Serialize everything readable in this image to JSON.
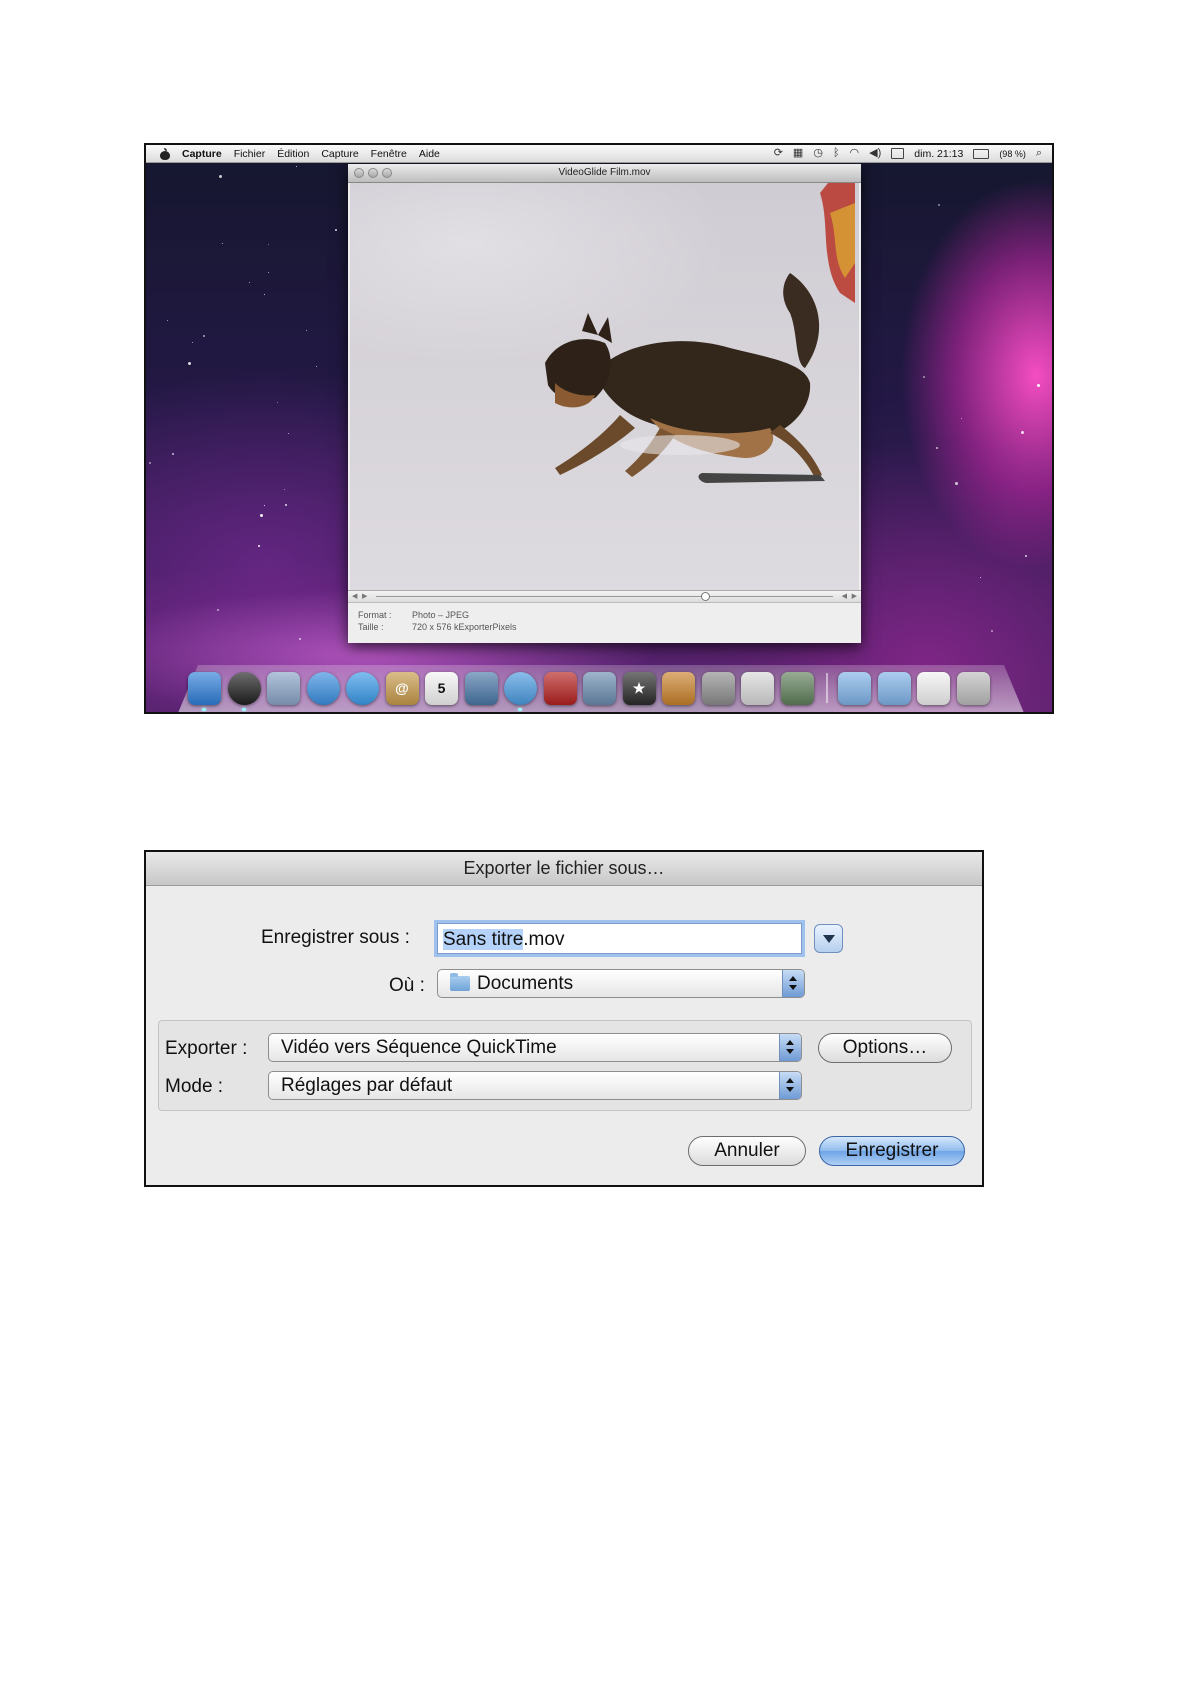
{
  "desktop": {
    "menubar": {
      "app_name": "Capture",
      "items": [
        "Fichier",
        "Édition",
        "Capture",
        "Fenêtre",
        "Aide"
      ],
      "clock": "dim. 21:13",
      "battery": "(98 %)"
    },
    "video_window": {
      "title": "VideoGlide Film.mov",
      "playhead_fraction": 0.72,
      "info": [
        {
          "label": "Format :",
          "value": "Photo – JPEG"
        },
        {
          "label": "Taille :",
          "value": "720 x 576 kExporterPixels"
        }
      ]
    },
    "dock": {
      "apps": [
        {
          "name": "finder-icon",
          "color": "#2f7fd8",
          "glyph": "",
          "round": false
        },
        {
          "name": "dashboard-icon",
          "color": "#1f1f1f",
          "glyph": "",
          "round": true
        },
        {
          "name": "mail-icon",
          "color": "#8aa4c8",
          "glyph": "",
          "round": false
        },
        {
          "name": "safari-icon",
          "color": "#3a8fe0",
          "glyph": "",
          "round": true
        },
        {
          "name": "ichat-icon",
          "color": "#3a9ae8",
          "glyph": "",
          "round": true
        },
        {
          "name": "address-book-icon",
          "color": "#c79a4a",
          "glyph": "@",
          "round": false
        },
        {
          "name": "ical-icon",
          "color": "#f4f4f4",
          "glyph": "5",
          "round": false
        },
        {
          "name": "preview-icon",
          "color": "#4a78a8",
          "glyph": "",
          "round": false
        },
        {
          "name": "itunes-icon",
          "color": "#4b9be0",
          "glyph": "",
          "round": true
        },
        {
          "name": "front-row-icon",
          "color": "#b5211f",
          "glyph": "",
          "round": false
        },
        {
          "name": "iphoto-icon",
          "color": "#6a8cb0",
          "glyph": "",
          "round": false
        },
        {
          "name": "imovie-icon",
          "color": "#2a2a2a",
          "glyph": "★",
          "round": false
        },
        {
          "name": "garageband-icon",
          "color": "#c9822b",
          "glyph": "",
          "round": false
        },
        {
          "name": "system-preferences-icon",
          "color": "#8d8d8d",
          "glyph": "",
          "round": false
        },
        {
          "name": "utility-icon",
          "color": "#d8d8d8",
          "glyph": "",
          "round": false
        },
        {
          "name": "notes-icon",
          "color": "#5f7f5a",
          "glyph": "",
          "round": false
        }
      ],
      "stacks": [
        {
          "name": "applications-folder-icon",
          "color": "#7fb3e8"
        },
        {
          "name": "documents-folder-icon",
          "color": "#7fb3e8"
        },
        {
          "name": "pdf-document-icon",
          "color": "#f2f2f2"
        },
        {
          "name": "trash-icon",
          "color": "#bdbdbd"
        }
      ]
    }
  },
  "dialog": {
    "title": "Exporter le fichier sous…",
    "save_as_label": "Enregistrer sous :",
    "filename_selected": "Sans titre",
    "filename_rest": ".mov",
    "where_label": "Où :",
    "where_value": "Documents",
    "export_label": "Exporter :",
    "export_value": "Vidéo vers Séquence QuickTime",
    "options_label": "Options…",
    "mode_label": "Mode :",
    "mode_value": "Réglages par défaut",
    "cancel_label": "Annuler",
    "save_label": "Enregistrer"
  }
}
